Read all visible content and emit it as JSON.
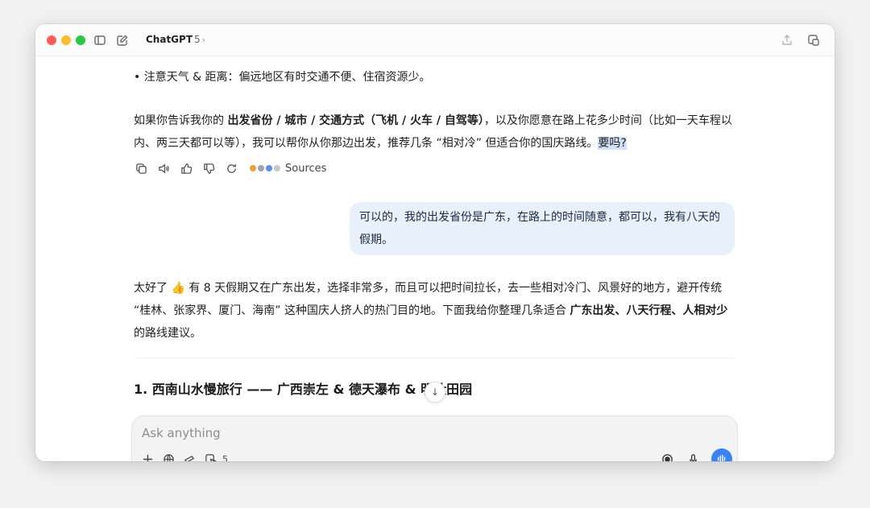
{
  "window": {
    "model_name": "ChatGPT",
    "model_version": "5",
    "chevron": "›"
  },
  "assistant_prev": {
    "bullet_line": "• 注意天气 & 距离：偏远地区有时交通不便、住宿资源少。",
    "para_1": "如果你告诉我你的 ",
    "para_bold": "出发省份 / 城市 / 交通方式（飞机 / 火车 / 自驾等）",
    "para_2": "，以及你愿意在路上花多少时间（比如一天车程以内、两三天都可以等），我可以帮你从你那边出发，推荐几条 “相对冷” 但适合你的国庆路线。",
    "para_highlight": "要吗?"
  },
  "actions": {
    "sources_label": "Sources"
  },
  "user_message": {
    "text": "可以的，我的出发省份是广东，在路上的时间随意，都可以，我有八天的假期。"
  },
  "assistant_reply": {
    "line_1": "太好了 👍 有 8 天假期又在广东出发，选择非常多，而且可以把时间拉长，去一些相对冷门、风景好的地方，避开传统 “桂林、张家界、厦门、海南” 这种国庆人挤人的热门目的地。下面我给你整理几条适合 ",
    "bold": "广东出发、八天行程、人相对少",
    "line_2": " 的路线建议。"
  },
  "section": {
    "heading": "1. 西南山水慢旅行 —— 广西崇左 & 德天瀑布 & 明仕田园"
  },
  "composer": {
    "placeholder": "Ask anything",
    "tool_count": "5"
  },
  "scroll_button": {
    "arrow": "↓"
  },
  "colors": {
    "accent": "#3b82f6",
    "user_bubble": "#e8f0fb",
    "highlight": "#cfe0f7"
  }
}
